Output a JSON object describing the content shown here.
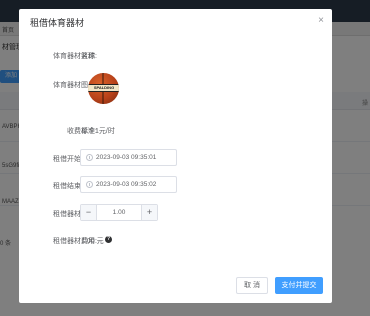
{
  "background": {
    "tab_label": "首页",
    "crumb": "材管理",
    "add_button": "添加",
    "row_texts": [
      "AVBPH",
      "5sG9fiz",
      "MAAZ"
    ],
    "right_col": "操",
    "pager_text": "0 条"
  },
  "dialog": {
    "title": "租借体育器材",
    "close_icon": "×",
    "fields": {
      "name_label": "体育器材名称:",
      "name_value": "篮球",
      "image_label": "体育器材图片:",
      "ball_text": "SPALDING",
      "fee_std_label": "收费标准:",
      "fee_std_value": "单个1元/时",
      "start_label": "租借开始时间:",
      "start_value": "2023-09-03 09:35:01",
      "end_label": "租借结束时间:",
      "end_value": "2023-09-03 09:35:02",
      "qty_label": "租借器材数量:",
      "qty_value": "1.00",
      "qty_minus": "−",
      "qty_plus": "+",
      "cost_label": "租借器材费用:",
      "cost_value": "1.00 元",
      "help_icon": "?"
    },
    "buttons": {
      "cancel": "取 消",
      "submit": "支付并提交"
    }
  },
  "colors": {
    "primary": "#409eff",
    "overlay": "rgba(0,0,0,0.5)"
  }
}
